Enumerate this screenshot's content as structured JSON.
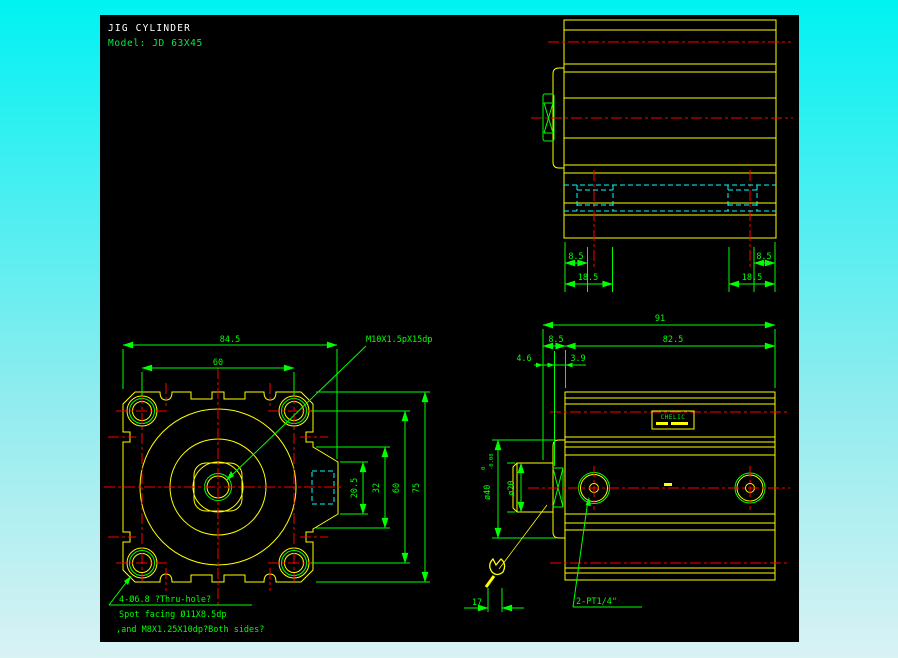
{
  "window": {
    "title_line1": "JIG CYLINDER",
    "title_line2": "Model: JD 63X45"
  },
  "colors": {
    "background_top": "#00f2f2",
    "background_bottom": "#d9f2f4",
    "canvas": "#000000",
    "geometry": "#ffff00",
    "dimension": "#00ff00",
    "centerline": "#ff0000",
    "hidden_line": "#00ffff",
    "title_text": "#ffffff"
  },
  "front_view": {
    "dim_width": "84.5",
    "dim_bolt_spacing_horizontal": "60",
    "dim_port_boss": "20.5",
    "dim_lug_base": "32",
    "dim_bolt_spacing_vertical": "60",
    "dim_height": "75",
    "thread_note": "M10X1.5pX15dp",
    "hole_note_line1": "4-Ø6.8 ?Thru-hole?",
    "hole_note_line2": "Spot facing Ø11X8.5dp",
    "hole_note_line3": ",and M8X1.25X10dp?Both sides?"
  },
  "top_view": {
    "dim_left_offset": "8.5",
    "dim_left_pitch": "18.5",
    "dim_right_offset": "8.5",
    "dim_right_pitch": "18.5"
  },
  "side_view": {
    "dim_total_length": "91",
    "dim_head": "8.5",
    "dim_body_length": "82.5",
    "dim_a": "4.6",
    "dim_b": "3.9",
    "dim_boss_dia": "ø40",
    "boss_tol_upper": "0",
    "boss_tol_lower": "-0.08",
    "dim_rod_dia": "ø20",
    "dim_wrench_flats": "17",
    "port_note": "2-PT1/4\"",
    "brand_label": "CHELIC"
  }
}
